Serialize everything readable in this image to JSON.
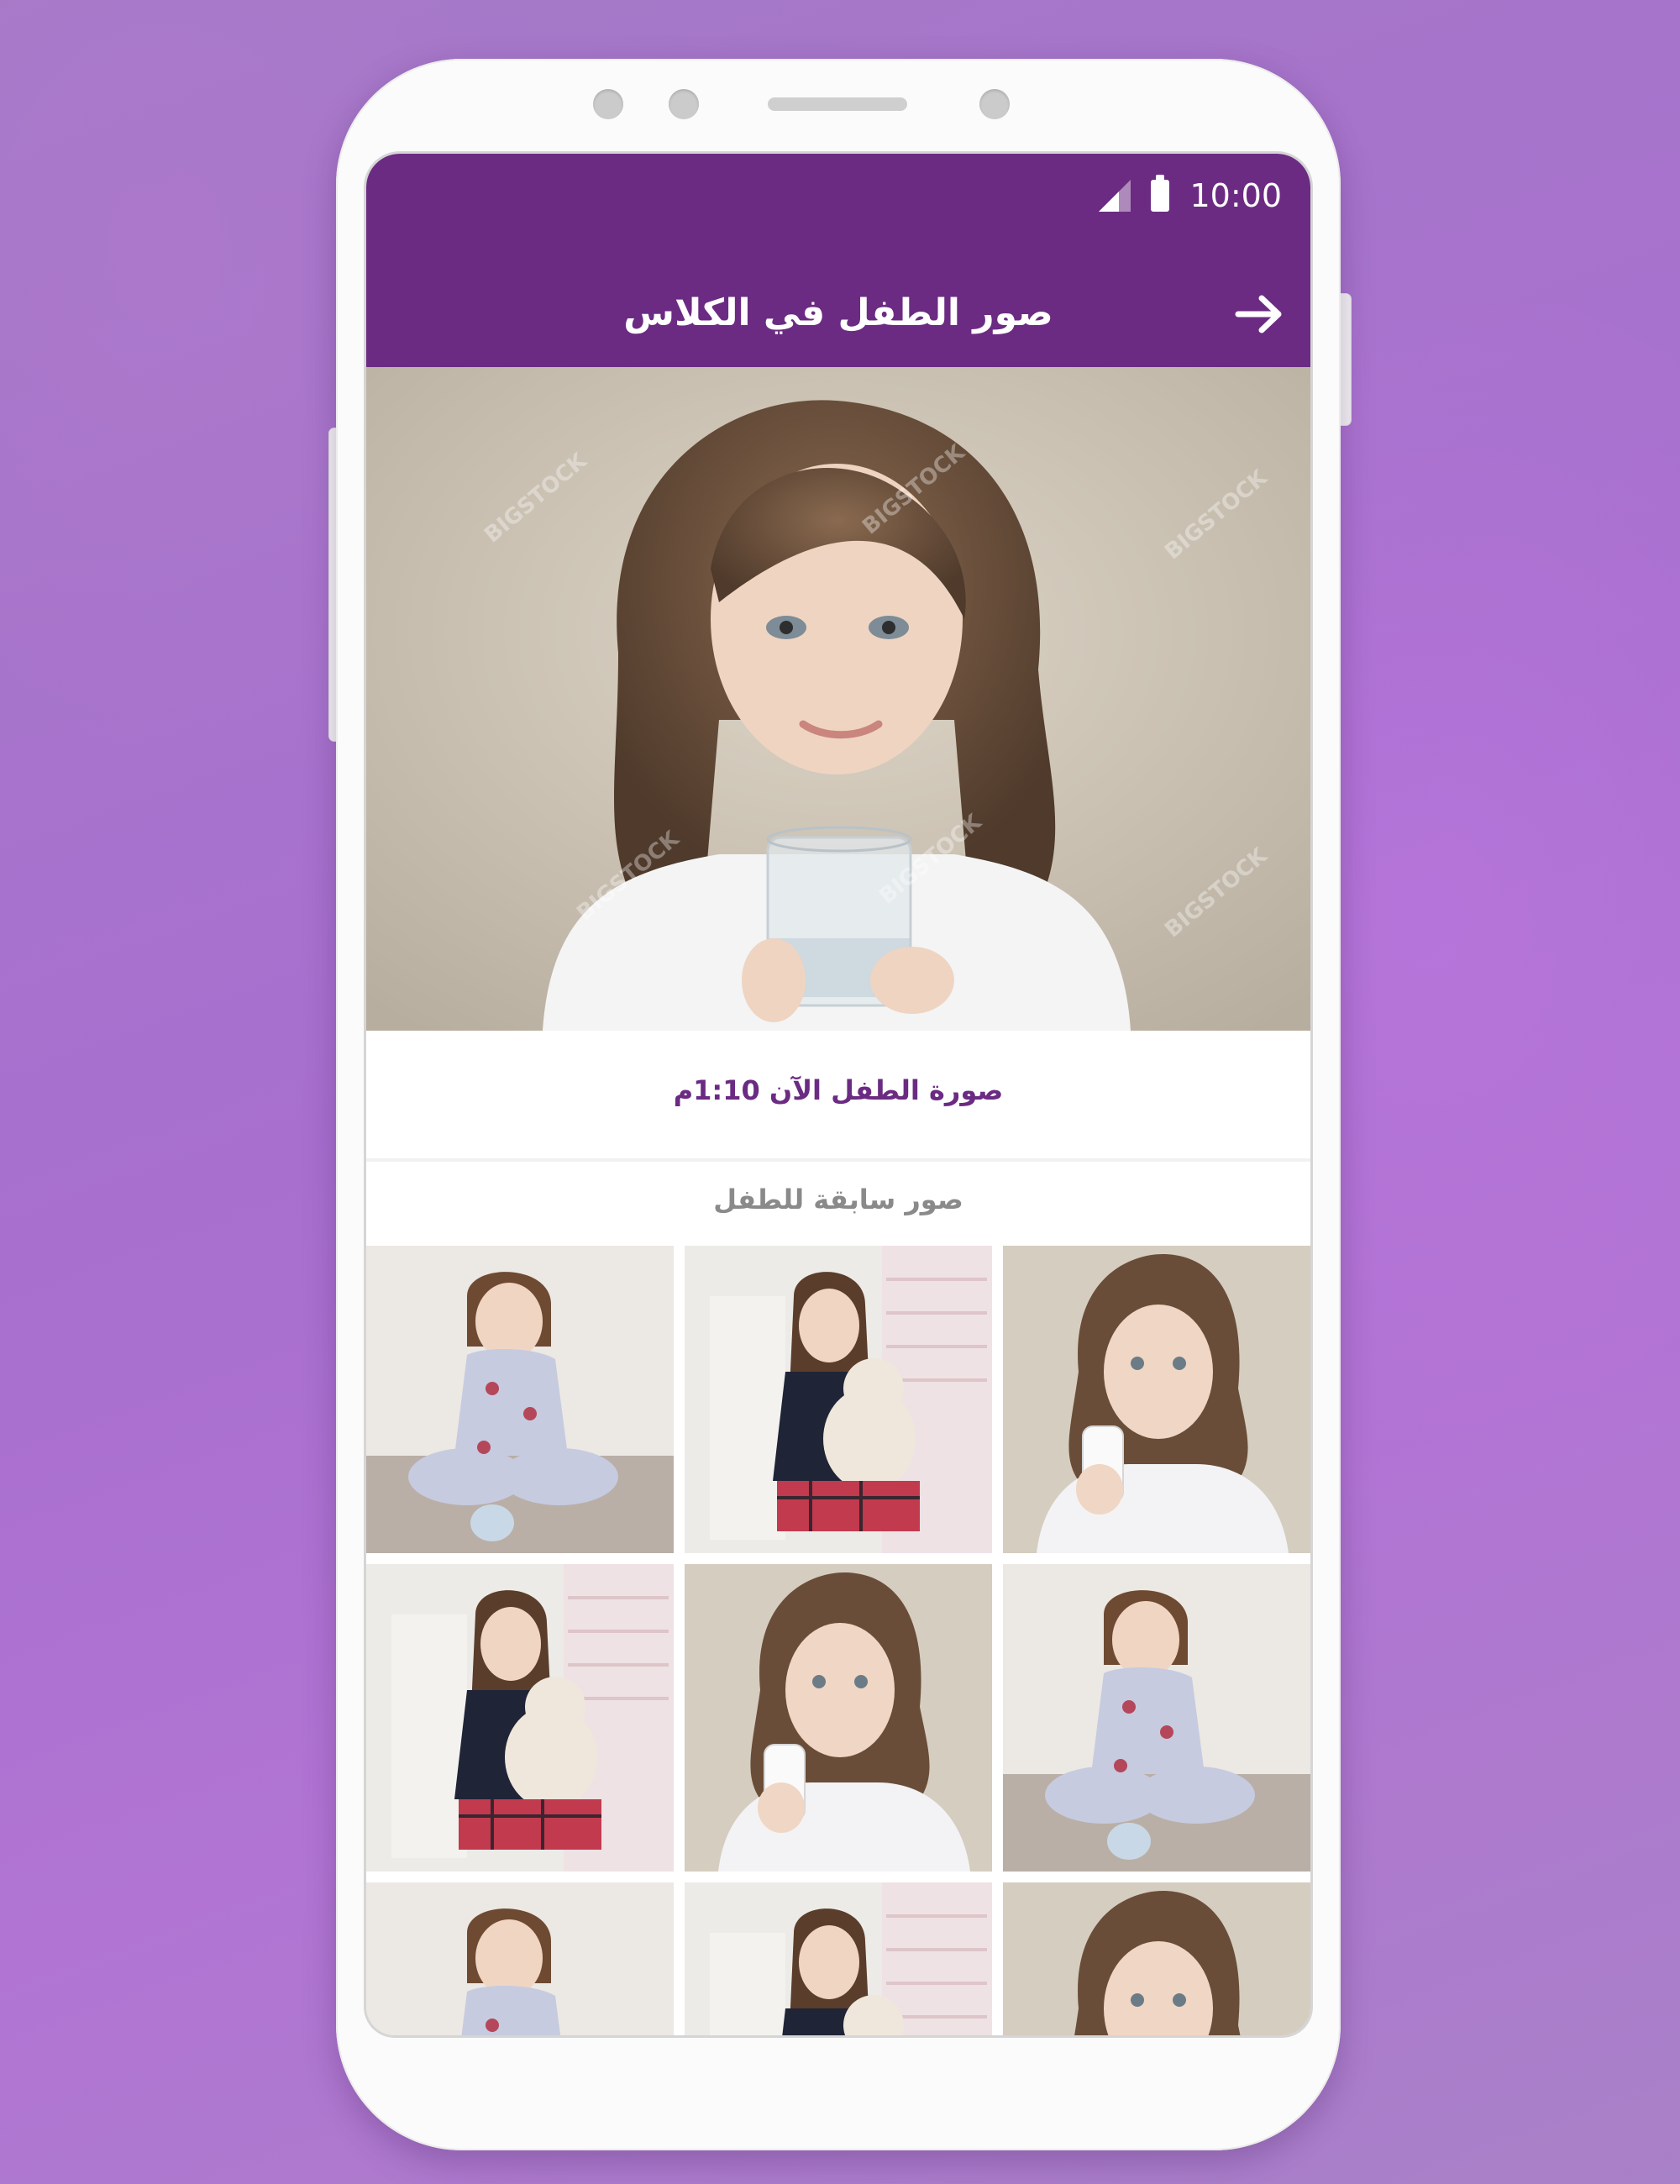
{
  "status_bar": {
    "time": "10:00"
  },
  "header": {
    "title": "صور الطفل في الكلاس"
  },
  "current_photo": {
    "caption": "صورة الطفل الآن 1:10م"
  },
  "previous_photos": {
    "label": "صور سابقة للطفل",
    "thumbnails": [
      "girl-sitting-pajamas",
      "girl-with-teddy-bear",
      "girl-with-bottle",
      "girl-with-teddy-bear",
      "girl-with-bottle",
      "girl-sitting-pajamas",
      "girl-sitting-pajamas",
      "girl-with-teddy-bear",
      "girl-with-bottle"
    ]
  },
  "watermark": "BIGSTOCK",
  "colors": {
    "app_bar": "#6b2b82",
    "caption": "#6b2b82",
    "section_label": "#8a8a8a",
    "background": "#a97ccb"
  }
}
